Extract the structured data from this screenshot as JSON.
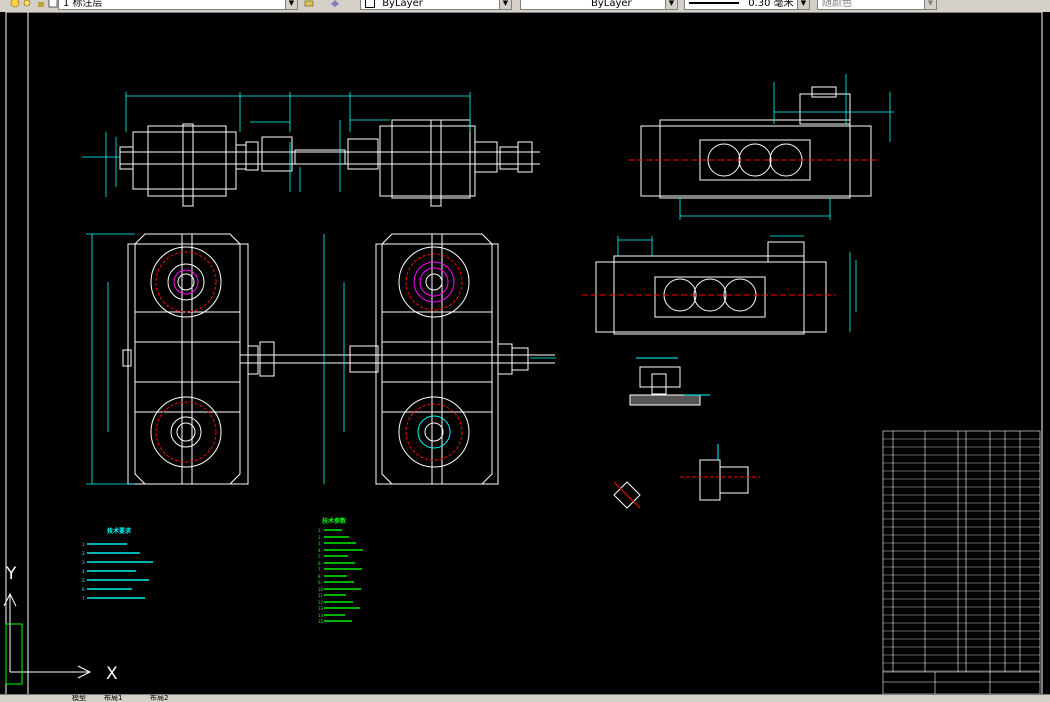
{
  "toolbar": {
    "layer_name": "1 标注层",
    "color_value": "ByLayer",
    "linetype_value": "ByLayer",
    "lineweight_value": "0.30 毫米",
    "plotstyle_value": "随颜色"
  },
  "drawing": {
    "tech_req_title": "技术要求",
    "tech_req_items": [
      "1.",
      "2.",
      "3.",
      "4.",
      "5.",
      "6.",
      "7."
    ],
    "spec_title": "技术参数",
    "spec_items": [
      "1.",
      "2.",
      "3.",
      "4.",
      "5.",
      "6.",
      "7.",
      "8.",
      "9.",
      "10.",
      "11.",
      "12.",
      "13.",
      "14.",
      "15."
    ],
    "ucs_y": "Y",
    "ucs_x": "X"
  },
  "tabs": {
    "model": "模型",
    "layout1": "布局1",
    "layout2": "布局2"
  },
  "colors": {
    "background": "#000000",
    "lines": "#ffffff",
    "dimensions": "#00ffff",
    "centerlines": "#ff0000",
    "notes_cyan": "#00ffff",
    "notes_green": "#00ff00",
    "magenta": "#ff00ff"
  }
}
